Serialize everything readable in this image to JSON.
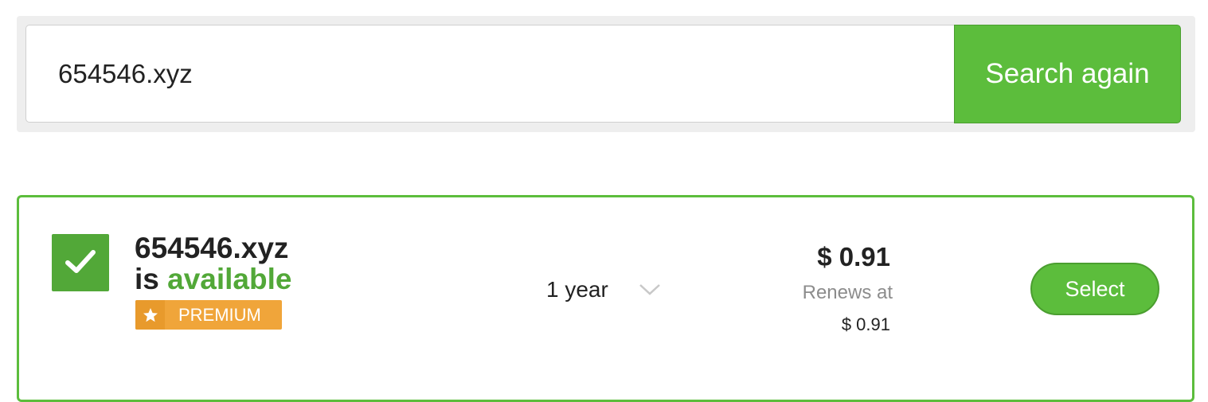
{
  "search": {
    "value": "654546.xyz",
    "button_label": "Search again"
  },
  "result": {
    "domain": "654546.xyz",
    "status_prefix": "is",
    "status_word": "available",
    "badge_label": "PREMIUM",
    "term": "1 year",
    "price": "$ 0.91",
    "renews_label": "Renews at",
    "renews_price": "$ 0.91",
    "select_label": "Select"
  },
  "colors": {
    "accent_green": "#5cbd3c",
    "status_green": "#52a838",
    "premium_orange": "#f0a53a"
  },
  "icons": {
    "check": "checkmark-icon",
    "premium": "star-icon",
    "term_dropdown": "chevron-down-icon"
  }
}
